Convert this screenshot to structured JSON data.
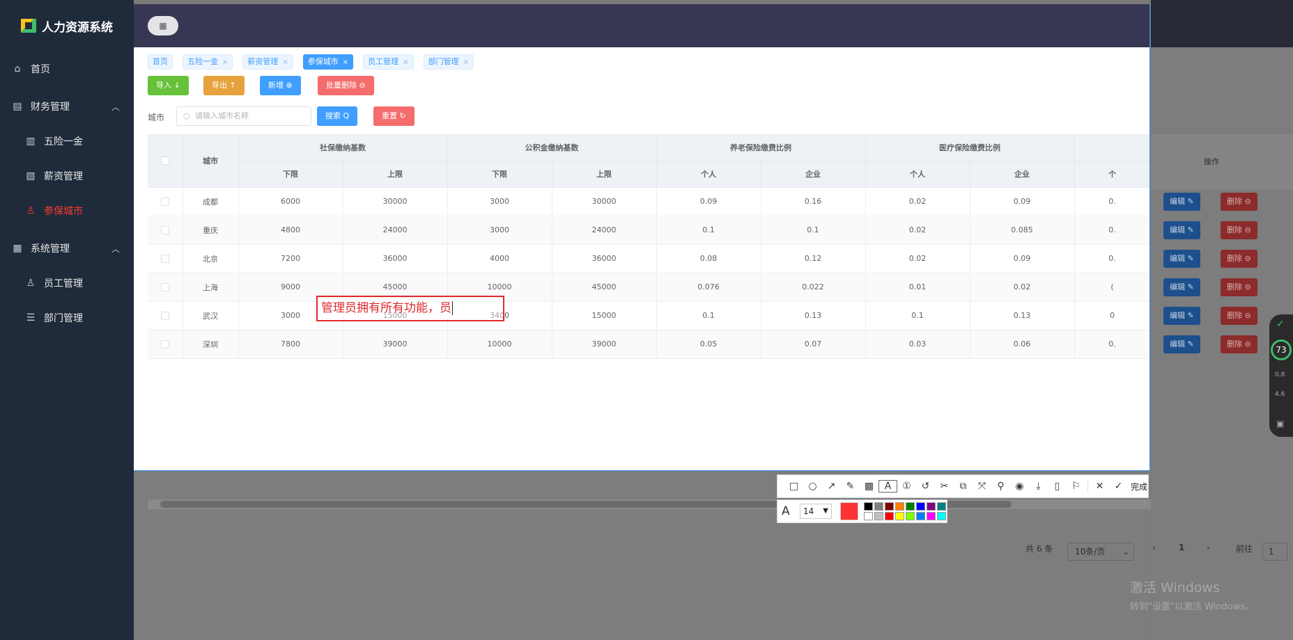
{
  "app": {
    "title": "人力资源系统"
  },
  "sidebar": {
    "items": [
      {
        "label": "首页",
        "icon": "home-icon",
        "level": "top",
        "active": false
      },
      {
        "label": "财务管理",
        "icon": "briefcase-icon",
        "level": "top",
        "expanded": true
      },
      {
        "label": "五险一金",
        "icon": "bar-chart-icon",
        "level": "sub",
        "active": false
      },
      {
        "label": "薪资管理",
        "icon": "money-chart-icon",
        "level": "sub",
        "active": false
      },
      {
        "label": "参保城市",
        "icon": "user-icon",
        "level": "sub",
        "active": true
      },
      {
        "label": "系统管理",
        "icon": "building-icon",
        "level": "top",
        "expanded": true
      },
      {
        "label": "员工管理",
        "icon": "person-icon",
        "level": "sub",
        "active": false
      },
      {
        "label": "部门管理",
        "icon": "sliders-icon",
        "level": "sub",
        "active": false
      }
    ]
  },
  "tags": [
    {
      "label": "首页",
      "closable": false,
      "active": false
    },
    {
      "label": "五险一金",
      "closable": true,
      "active": false
    },
    {
      "label": "薪资管理",
      "closable": true,
      "active": false
    },
    {
      "label": "参保城市",
      "closable": true,
      "active": true
    },
    {
      "label": "员工管理",
      "closable": true,
      "active": false
    },
    {
      "label": "部门管理",
      "closable": true,
      "active": false
    }
  ],
  "toolbar": {
    "import_label": "导入 ↓",
    "export_label": "导出 ↑",
    "add_label": "新增 ⊕",
    "batch_delete_label": "批量删除 ⊖"
  },
  "search": {
    "label": "城市",
    "placeholder": "请输入城市名称",
    "search_label": "搜索 Q",
    "reset_label": "重置 ↻"
  },
  "table": {
    "col_city": "城市",
    "groups": [
      "社保缴纳基数",
      "公积金缴纳基数",
      "养老保险缴费比例",
      "医疗保险缴费比例"
    ],
    "subheaders": [
      "下限",
      "上限",
      "下限",
      "上限",
      "个人",
      "企业",
      "个人",
      "企业",
      "个"
    ],
    "ops_header": "操作",
    "rows": [
      [
        "成都",
        "6000",
        "30000",
        "3000",
        "30000",
        "0.09",
        "0.16",
        "0.02",
        "0.09",
        "0."
      ],
      [
        "重庆",
        "4800",
        "24000",
        "3000",
        "24000",
        "0.1",
        "0.1",
        "0.02",
        "0.085",
        "0."
      ],
      [
        "北京",
        "7200",
        "36000",
        "4000",
        "36000",
        "0.08",
        "0.12",
        "0.02",
        "0.09",
        "0."
      ],
      [
        "上海",
        "9000",
        "45000",
        "10000",
        "45000",
        "0.076",
        "0.022",
        "0.01",
        "0.02",
        "("
      ],
      [
        "武汉",
        "3000",
        "15000",
        "3400",
        "15000",
        "0.1",
        "0.13",
        "0.1",
        "0.13",
        "0"
      ],
      [
        "深圳",
        "7800",
        "39000",
        "10000",
        "39000",
        "0.05",
        "0.07",
        "0.03",
        "0.06",
        "0."
      ]
    ],
    "edit_label": "编辑 ✎",
    "delete_label": "删除 ⊖"
  },
  "annotation": {
    "text": "管理员拥有所有功能，员"
  },
  "pagination": {
    "total": "共 6 条",
    "page_size": "10条/页",
    "prev": "‹",
    "current": "1",
    "next": "›",
    "goto": "前往",
    "goto_value": "1"
  },
  "snip": {
    "done_label": "完成",
    "font_size": "14",
    "font_icon": "A",
    "colors": [
      "#000000",
      "#808080",
      "#800000",
      "#ff8000",
      "#008000",
      "#0000ff",
      "#800080",
      "#008080",
      "#ffffff",
      "#c0c0c0",
      "#ff0000",
      "#ffff00",
      "#80ff00",
      "#0080ff",
      "#ff00ff",
      "#00ffff"
    ],
    "current_color": "#ff3333"
  },
  "windows": {
    "activate_line1": "激活 Windows",
    "activate_line2": "转到\"设置\"以激活 Windows。"
  },
  "widget": {
    "score": "73",
    "up": "0.8",
    "down": "4.6"
  }
}
